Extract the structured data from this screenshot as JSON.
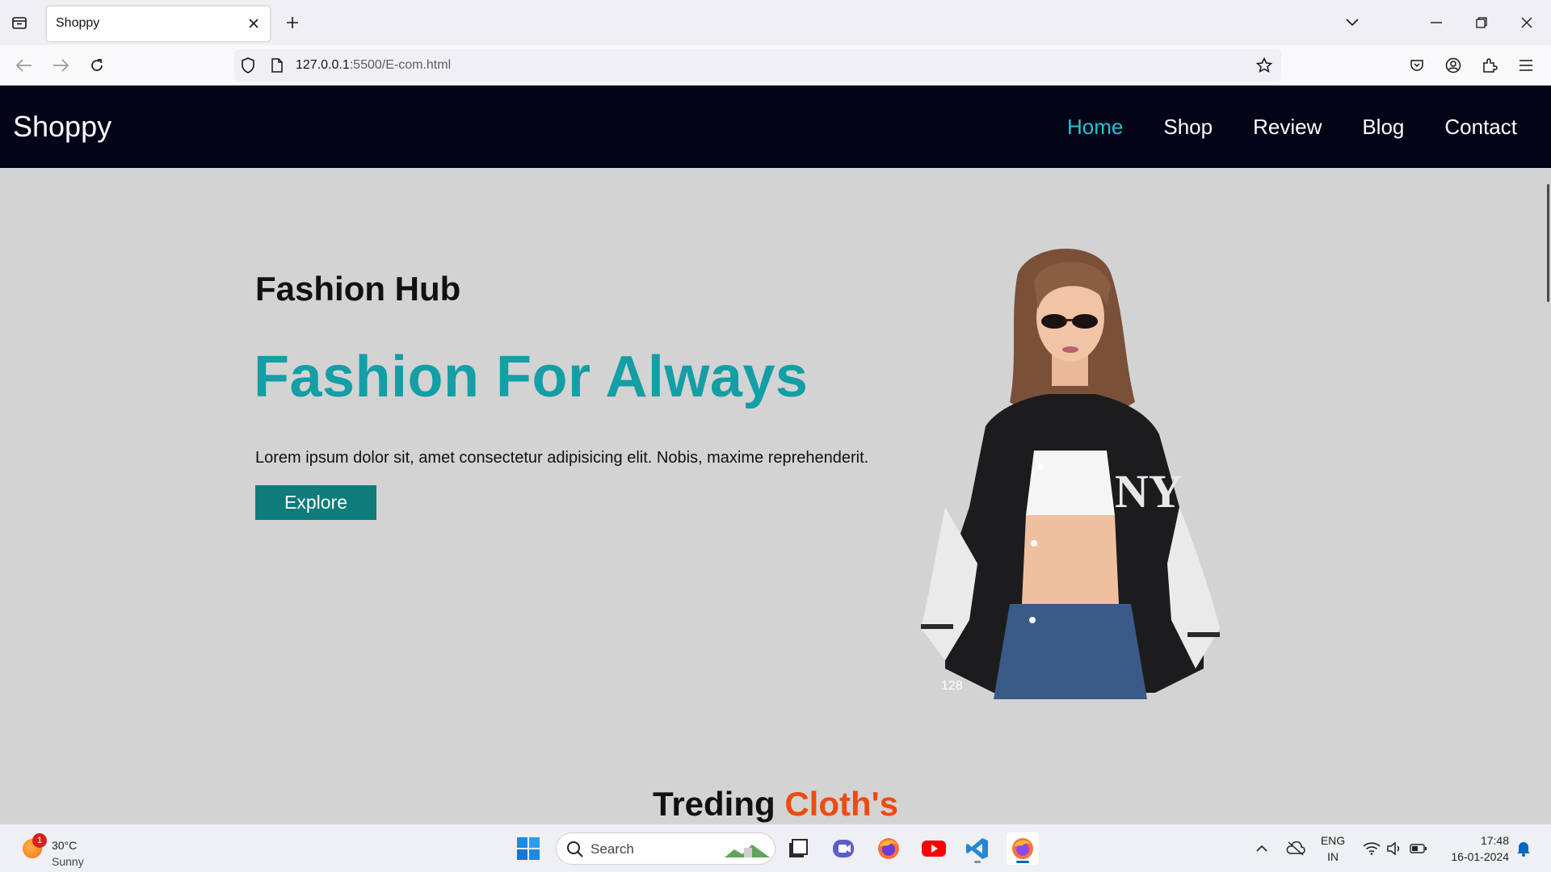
{
  "browser": {
    "tab_title": "Shoppy",
    "url_host": "127.0.0.1",
    "url_rest": ":5500/E-com.html"
  },
  "site": {
    "logo": "Shoppy",
    "nav": [
      {
        "label": "Home",
        "active": true
      },
      {
        "label": "Shop",
        "active": false
      },
      {
        "label": "Review",
        "active": false
      },
      {
        "label": "Blog",
        "active": false
      },
      {
        "label": "Contact",
        "active": false
      }
    ],
    "hero": {
      "subtitle": "Fashion Hub",
      "title": "Fashion For Always",
      "text": "Lorem ipsum dolor sit, amet consectetur adipisicing elit. Nobis, maxime reprehenderit.",
      "button": "Explore",
      "image_caption": "128"
    },
    "section": {
      "title_main": "Treding ",
      "title_accent": "Cloth's"
    },
    "colors": {
      "header_bg": "#020418",
      "accent": "#29c2d0",
      "hero_title": "#149ea6",
      "button_bg": "#0f7c7a",
      "section_accent": "#f04a10",
      "page_bg": "#d3d3d3"
    }
  },
  "taskbar": {
    "weather_temp": "30°C",
    "weather_cond": "Sunny",
    "weather_badge": "1",
    "search_placeholder": "Search",
    "lang_top": "ENG",
    "lang_bottom": "IN",
    "time": "17:48",
    "date": "16-01-2024",
    "apps": [
      "start-icon",
      "search-icon",
      "task-view-icon",
      "teams-icon",
      "firefox-icon",
      "youtube-icon",
      "vscode-icon",
      "firefox-dev-icon"
    ]
  }
}
